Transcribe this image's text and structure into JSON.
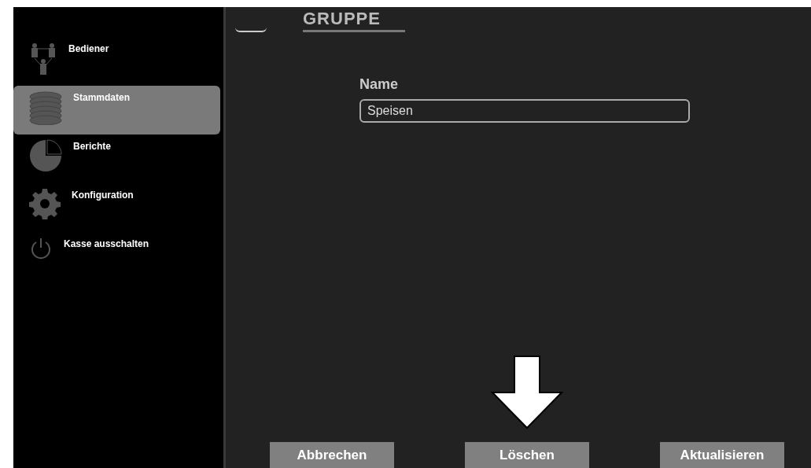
{
  "sidebar": {
    "items": [
      {
        "kind": "operators",
        "label": "Bediener",
        "selected": false
      },
      {
        "kind": "masterdata",
        "label": "Stammdaten",
        "selected": true
      },
      {
        "kind": "reports",
        "label": "Berichte",
        "selected": false
      },
      {
        "kind": "config",
        "label": "Konfiguration",
        "selected": false
      },
      {
        "kind": "power",
        "label": "Kasse ausschalten",
        "selected": false
      }
    ]
  },
  "main": {
    "title": "GRUPPE",
    "field": {
      "label": "Name",
      "value": "Speisen"
    },
    "buttons": [
      {
        "label": "Abbrechen"
      },
      {
        "label": "Löschen",
        "highlighted": true
      },
      {
        "label": "Aktualisieren"
      }
    ]
  }
}
